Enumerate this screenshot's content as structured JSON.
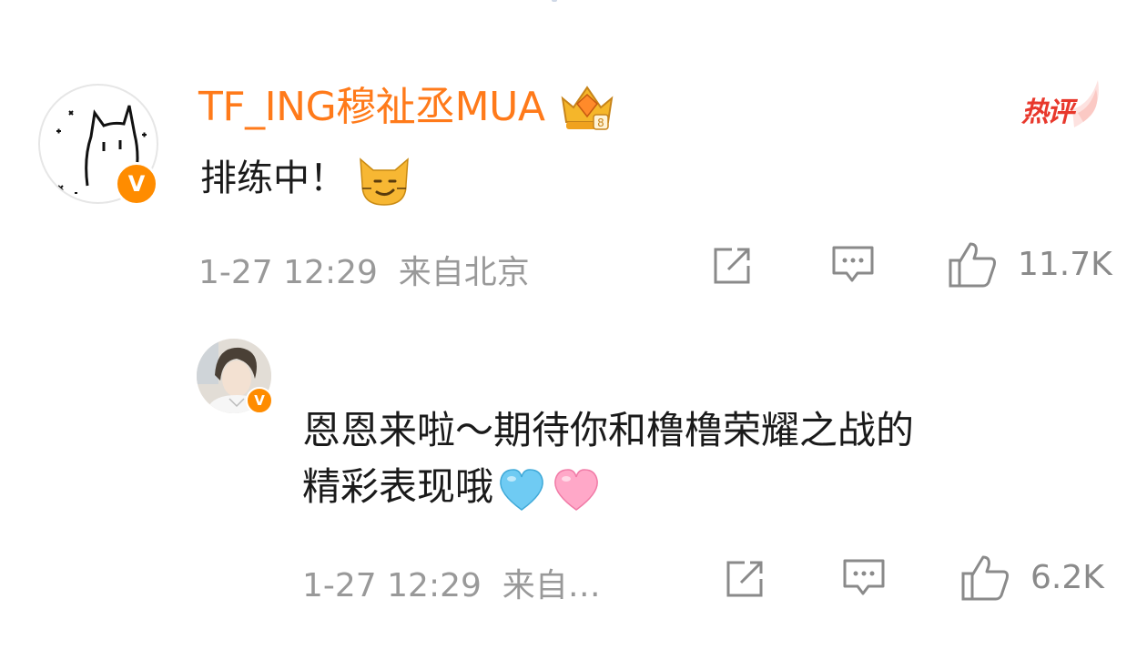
{
  "comment": {
    "username": "TF_ING穆祉丞MUA",
    "hot_label": "热评",
    "text": "排练中！",
    "emoji": "smirking-cat-emoji",
    "time": "1-27 12:29",
    "location": "来自北京",
    "like_count": "11.7K"
  },
  "reply": {
    "text_line1": "恩恩来啦～期待你和橹橹荣耀之战的",
    "text_line2": "精彩表现哦",
    "emojis": [
      "light-blue-heart-emoji",
      "pink-heart-emoji"
    ],
    "time": "1-27 12:29",
    "location": "来自…",
    "like_count": "6.2K"
  },
  "verified_badge": "V",
  "colors": {
    "username": "#ff7a1a",
    "hot": "#e8382c",
    "badge": "#ff8c00",
    "meta": "#999999"
  }
}
